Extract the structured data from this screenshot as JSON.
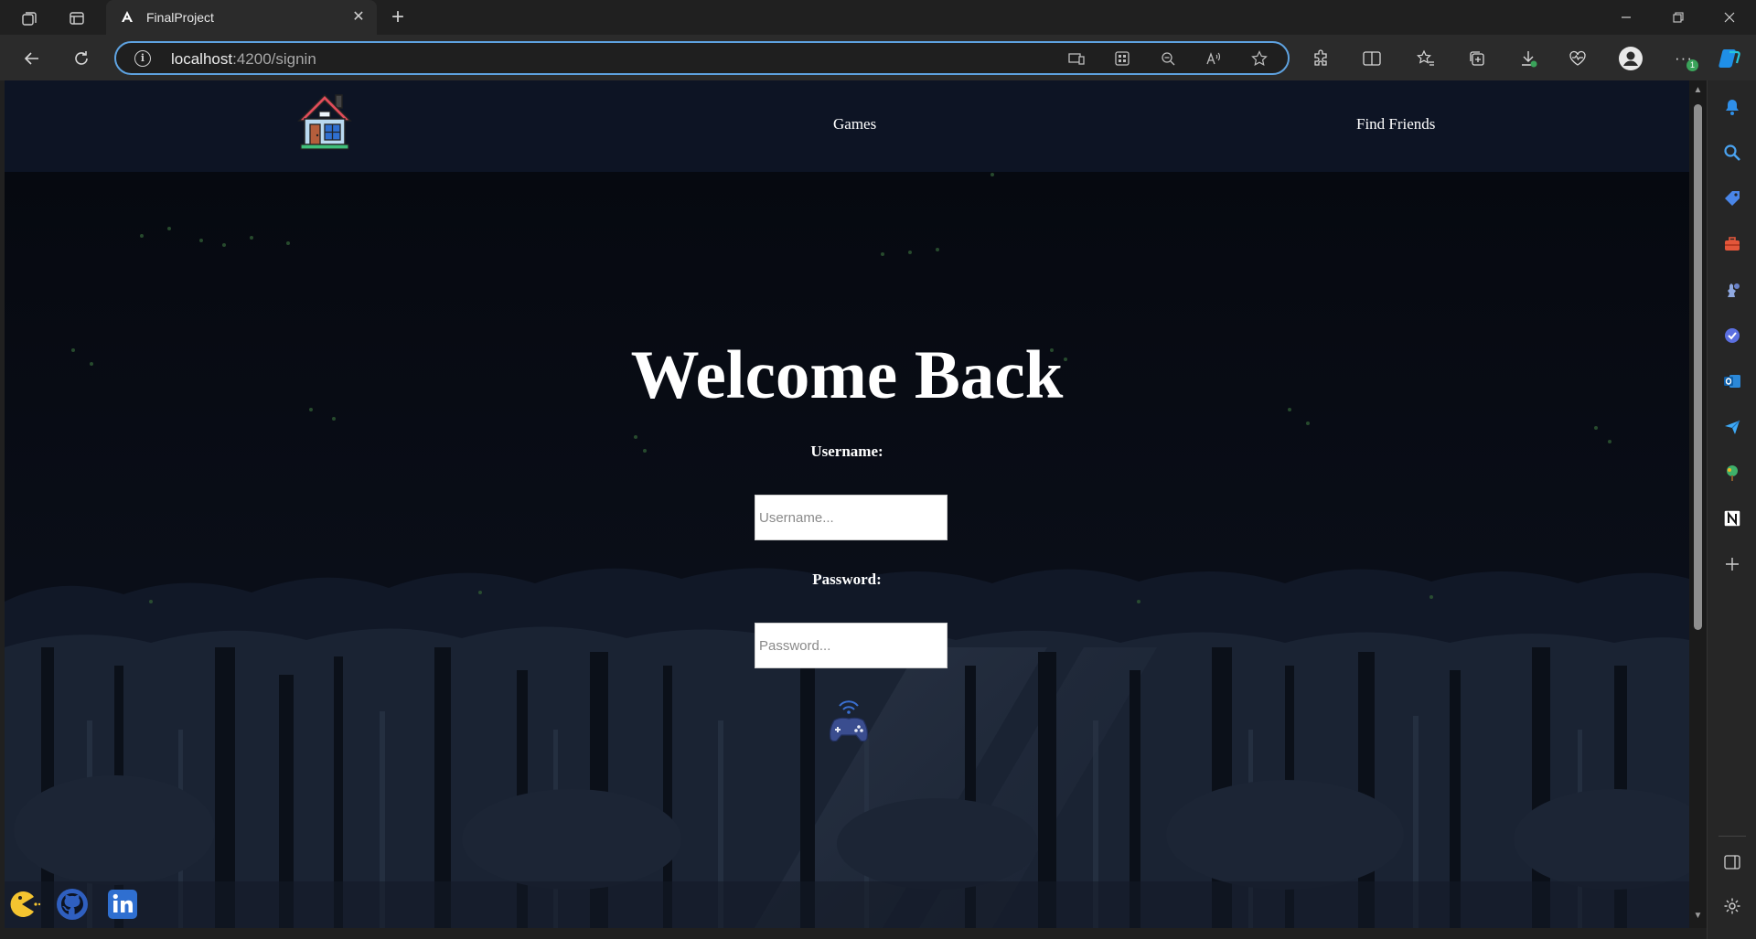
{
  "browser": {
    "tab_title": "FinalProject",
    "url_host": "localhost",
    "url_path": ":4200/signin",
    "copilot_badge": "1"
  },
  "site": {
    "nav": {
      "games_label": "Games",
      "find_friends_label": "Find Friends"
    },
    "signin": {
      "heading": "Welcome Back",
      "username_label": "Username:",
      "username_placeholder": "Username...",
      "password_label": "Password:",
      "password_placeholder": "Password..."
    },
    "footer_links": [
      "pacman-icon",
      "github-icon",
      "linkedin-icon"
    ]
  },
  "colors": {
    "nav_bg": "#0d1424",
    "page_bg": "#080b12",
    "address_focus": "#5ea2e0",
    "controller": "#3a4d8f"
  }
}
